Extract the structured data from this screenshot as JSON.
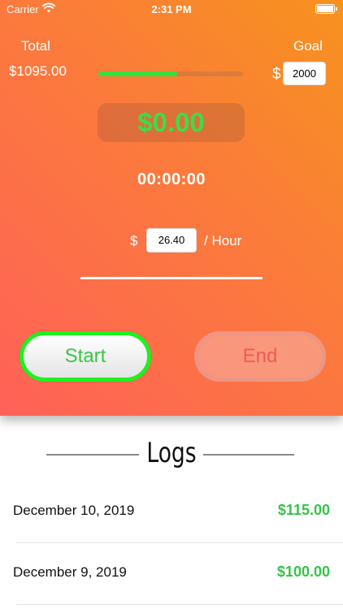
{
  "status_bar": {
    "carrier": "Carrier",
    "time": "2:31 PM"
  },
  "summary": {
    "total_label": "Total",
    "total_value": "$1095.00",
    "goal_label": "Goal",
    "goal_currency": "$",
    "goal_value": "2000",
    "progress_fraction": 0.5475
  },
  "session": {
    "earnings": "$0.00",
    "timer": "00:00:00",
    "rate_currency": "$",
    "rate_value": "26.40",
    "rate_unit": "/ Hour"
  },
  "buttons": {
    "start_label": "Start",
    "end_label": "End"
  },
  "logs": {
    "title": "Logs",
    "items": [
      {
        "date": "December 10, 2019",
        "amount": "$115.00"
      },
      {
        "date": "December 9, 2019",
        "amount": "$100.00"
      }
    ]
  },
  "colors": {
    "gradient_start": "#f7921e",
    "gradient_end": "#ff6158",
    "accent_green": "#37e03c",
    "end_red": "#ef5c52"
  }
}
